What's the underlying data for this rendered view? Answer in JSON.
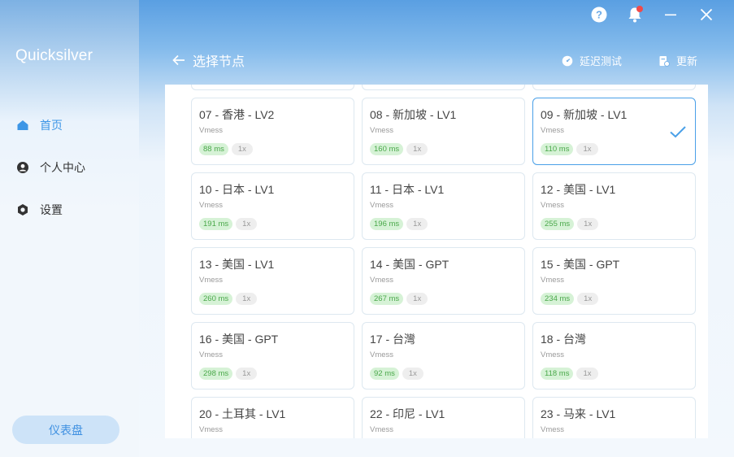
{
  "app": {
    "name": "Quicksilver"
  },
  "sidebar": {
    "items": [
      {
        "label": "首页",
        "icon": "home-icon",
        "active": true
      },
      {
        "label": "个人中心",
        "icon": "user-icon",
        "active": false
      },
      {
        "label": "设置",
        "icon": "gear-icon",
        "active": false
      }
    ],
    "dashboard_label": "仪表盘"
  },
  "header": {
    "title": "选择节点",
    "latency_test_label": "延迟测试",
    "update_label": "更新"
  },
  "window_controls": [
    "help-icon",
    "bell-icon",
    "minimize-icon",
    "close-icon"
  ],
  "colors": {
    "accent": "#3d96e6",
    "latency_bg": "#d6f2d6",
    "latency_text": "#4aa84a",
    "notification": "#f04a4a"
  },
  "nodes": [
    {
      "name": "",
      "protocol": "",
      "latency": "",
      "multiplier": ""
    },
    {
      "name": "",
      "protocol": "",
      "latency": "",
      "multiplier": ""
    },
    {
      "name": "",
      "protocol": "",
      "latency": "",
      "multiplier": ""
    },
    {
      "name": "07 - 香港 - LV2",
      "protocol": "Vmess",
      "latency": "88 ms",
      "multiplier": "1x"
    },
    {
      "name": "08 - 新加坡 - LV1",
      "protocol": "Vmess",
      "latency": "160 ms",
      "multiplier": "1x"
    },
    {
      "name": "09 - 新加坡 - LV1",
      "protocol": "Vmess",
      "latency": "110 ms",
      "multiplier": "1x",
      "selected": true
    },
    {
      "name": "10 - 日本 - LV1",
      "protocol": "Vmess",
      "latency": "191 ms",
      "multiplier": "1x"
    },
    {
      "name": "11 - 日本 - LV1",
      "protocol": "Vmess",
      "latency": "196 ms",
      "multiplier": "1x"
    },
    {
      "name": "12 - 美国 - LV1",
      "protocol": "Vmess",
      "latency": "255 ms",
      "multiplier": "1x"
    },
    {
      "name": "13 - 美国 - LV1",
      "protocol": "Vmess",
      "latency": "260 ms",
      "multiplier": "1x"
    },
    {
      "name": "14 - 美国 - GPT",
      "protocol": "Vmess",
      "latency": "267 ms",
      "multiplier": "1x"
    },
    {
      "name": "15 - 美国 - GPT",
      "protocol": "Vmess",
      "latency": "234 ms",
      "multiplier": "1x"
    },
    {
      "name": "16 - 美国 - GPT",
      "protocol": "Vmess",
      "latency": "298 ms",
      "multiplier": "1x"
    },
    {
      "name": "17 - 台灣",
      "protocol": "Vmess",
      "latency": "92 ms",
      "multiplier": "1x"
    },
    {
      "name": "18 - 台灣",
      "protocol": "Vmess",
      "latency": "118 ms",
      "multiplier": "1x"
    },
    {
      "name": "20 - 土耳其 - LV1",
      "protocol": "Vmess",
      "latency": "",
      "multiplier": ""
    },
    {
      "name": "22 - 印尼 - LV1",
      "protocol": "Vmess",
      "latency": "",
      "multiplier": ""
    },
    {
      "name": "23 - 马来 - LV1",
      "protocol": "Vmess",
      "latency": "",
      "multiplier": ""
    }
  ]
}
